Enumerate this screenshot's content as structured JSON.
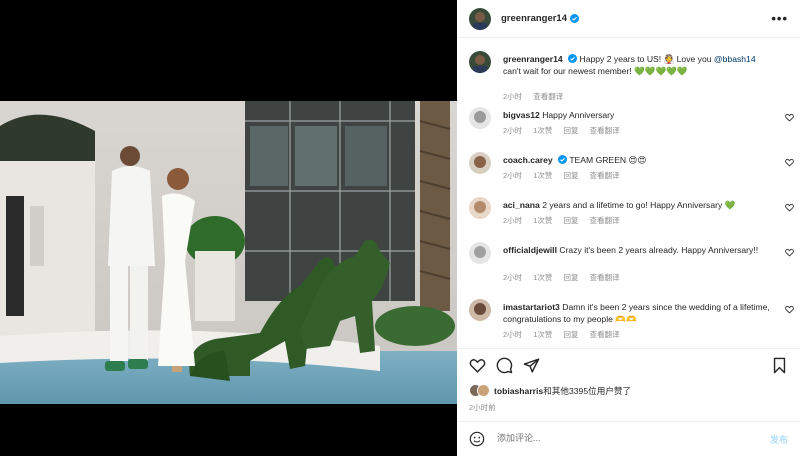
{
  "post": {
    "username": "greenranger14",
    "more_label": "•••"
  },
  "caption": {
    "username": "greenranger14",
    "text_before": "Happy 2 years to US! 👰 Love you ",
    "mention": "@bbash14",
    "text_after": " can't wait for our newest member! 💚💚💚💚💚",
    "time": "2小时",
    "translate": "查看翻译"
  },
  "comments": [
    {
      "username": "bigvas12",
      "text": "Happy Anniversary",
      "time": "2小时",
      "likes": "1次赞",
      "reply": "回复",
      "translate": "查看翻译"
    },
    {
      "username": "coach.carey",
      "text": "TEAM GREEN 😍😍",
      "time": "2小时",
      "likes": "1次赞",
      "reply": "回复",
      "translate": "查看翻译"
    },
    {
      "username": "aci_nana",
      "text": "2 years and a lifetime to go! Happy Anniversary 💚",
      "time": "2小时",
      "likes": "1次赞",
      "reply": "回复",
      "translate": "查看翻译"
    },
    {
      "username": "officialdjewill",
      "text": "Crazy it's been 2 years already. Happy Anniversary!!",
      "time": "2小时",
      "likes": "1次赞",
      "reply": "回复",
      "translate": "查看翻译"
    },
    {
      "username": "imastartariot3",
      "text": "Damn it's been 2 years since the wedding of a lifetime, congratulations to my people 🫶🫶",
      "time": "2小时",
      "likes": "1次赞",
      "reply": "回复",
      "translate": "查看翻译"
    }
  ],
  "likes_line": {
    "user": "tobiasharris",
    "rest": "和其他3395位用户赞了"
  },
  "post_time": "2小时前",
  "add_comment": {
    "placeholder": "添加评论...",
    "post_label": "发布"
  },
  "colors": {
    "accent_link": "#00376b",
    "verified": "#0095f6",
    "muted": "#8e8e8e",
    "post_disabled": "#b2dffc"
  }
}
